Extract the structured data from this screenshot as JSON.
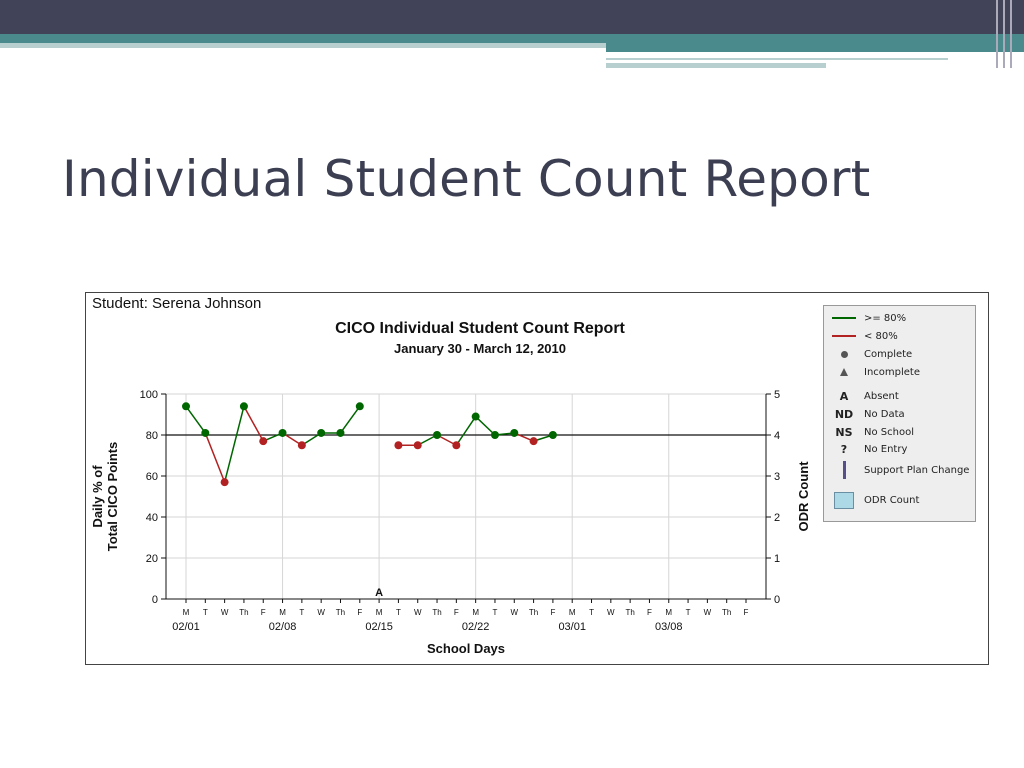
{
  "slide": {
    "title": "Individual Student Count Report"
  },
  "colors": {
    "band_dark": "#414458",
    "band_teal": "#4a8a8c",
    "band_light": "#b8cfd0",
    "title": "#3c3f52",
    "green": "#006600",
    "red": "#b22222"
  },
  "report": {
    "student": "Student: Serena Johnson",
    "title": "CICO Individual Student Count Report",
    "subtitle": "January 30 - March 12, 2010"
  },
  "legend": {
    "items": [
      {
        "symbol": "line-green",
        "label": ">= 80%"
      },
      {
        "symbol": "line-red",
        "label": "< 80%"
      },
      {
        "symbol": "dot",
        "label": "Complete"
      },
      {
        "symbol": "triangle",
        "label": "Incomplete"
      },
      {
        "symbol": "code",
        "code": "A",
        "label": "Absent"
      },
      {
        "symbol": "code",
        "code": "ND",
        "label": "No Data"
      },
      {
        "symbol": "code",
        "code": "NS",
        "label": "No School"
      },
      {
        "symbol": "code",
        "code": "?",
        "label": "No Entry"
      },
      {
        "symbol": "bar",
        "label": "Support Plan Change"
      },
      {
        "symbol": "box",
        "label": "ODR Count"
      }
    ]
  },
  "chart_data": {
    "type": "line",
    "title": "CICO Individual Student Count Report",
    "subtitle": "January 30 - March 12, 2010",
    "xlabel": "School Days",
    "ylabel": "Daily % of Total CICO Points",
    "y2label": "ODR Count",
    "ylim": [
      0,
      100
    ],
    "y2lim": [
      0,
      5
    ],
    "yticks": [
      0,
      20,
      40,
      60,
      80,
      100
    ],
    "y2ticks": [
      0,
      1,
      2,
      3,
      4,
      5
    ],
    "goal_line": 80,
    "day_labels": [
      "M",
      "T",
      "W",
      "Th",
      "F",
      "M",
      "T",
      "W",
      "Th",
      "F",
      "M",
      "T",
      "W",
      "Th",
      "F",
      "M",
      "T",
      "W",
      "Th",
      "F",
      "M",
      "T",
      "W",
      "Th",
      "F",
      "M",
      "T",
      "W",
      "Th",
      "F"
    ],
    "week_labels": [
      "02/01",
      "02/08",
      "02/15",
      "02/22",
      "03/01",
      "03/08"
    ],
    "week_label_days": [
      0,
      5,
      10,
      15,
      20,
      25
    ],
    "points": [
      {
        "day": 0,
        "value": 94
      },
      {
        "day": 1,
        "value": 81
      },
      {
        "day": 2,
        "value": 57
      },
      {
        "day": 3,
        "value": 94
      },
      {
        "day": 4,
        "value": 77
      },
      {
        "day": 5,
        "value": 81
      },
      {
        "day": 6,
        "value": 75
      },
      {
        "day": 7,
        "value": 81
      },
      {
        "day": 8,
        "value": 81
      },
      {
        "day": 9,
        "value": 94
      },
      {
        "day": 11,
        "value": 75
      },
      {
        "day": 12,
        "value": 75
      },
      {
        "day": 13,
        "value": 80
      },
      {
        "day": 14,
        "value": 75
      },
      {
        "day": 15,
        "value": 89
      },
      {
        "day": 16,
        "value": 80
      },
      {
        "day": 17,
        "value": 81
      },
      {
        "day": 18,
        "value": 77
      },
      {
        "day": 19,
        "value": 80
      }
    ],
    "annotations": [
      {
        "day": 10,
        "code": "A"
      }
    ],
    "threshold": 80,
    "grid": true,
    "legend_position": "right"
  }
}
